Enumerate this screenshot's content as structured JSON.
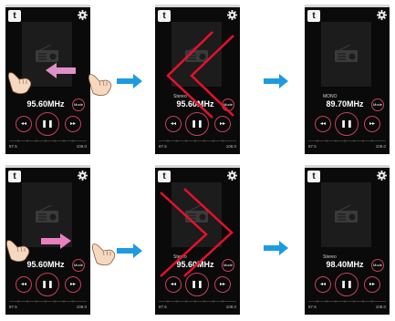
{
  "colors": {
    "accent": "#c8405a",
    "flow_arrow": "#1e9be0",
    "swipe_left": "#e090c8",
    "swipe_right": "#e87fc0",
    "gesture_chevron": "#e8102a"
  },
  "icons": {
    "back": "back-arrow-icon",
    "settings": "gear-icon",
    "radio": "radio-icon",
    "prev": "previous-icon",
    "play": "pause-icon",
    "next": "next-icon",
    "hand": "hand-pointer-icon",
    "flow": "right-arrow-icon"
  },
  "glyphs": {
    "back": "t",
    "prev": "◂◂",
    "pause": "❚❚",
    "next": "▸▸"
  },
  "phones": [
    {
      "stereo": "",
      "freq": "95.60MHz",
      "mode": "Mode",
      "scale_min": "87.5",
      "scale_max": "108.0"
    },
    {
      "stereo": "Stereo",
      "freq": "95.60MHz",
      "mode": "Mode",
      "scale_min": "87.5",
      "scale_max": "108.0"
    },
    {
      "stereo": "MONO",
      "freq": "89.70MHz",
      "mode": "Mode",
      "scale_min": "87.5",
      "scale_max": "108.0"
    },
    {
      "stereo": "",
      "freq": "95.60MHz",
      "mode": "Mode",
      "scale_min": "87.5",
      "scale_max": "108.0"
    },
    {
      "stereo": "Stereo",
      "freq": "95.60MHz",
      "mode": "Mode",
      "scale_min": "87.5",
      "scale_max": "108.0"
    },
    {
      "stereo": "Stereo",
      "freq": "98.40MHz",
      "mode": "Mode",
      "scale_min": "87.5",
      "scale_max": "108.0"
    }
  ]
}
